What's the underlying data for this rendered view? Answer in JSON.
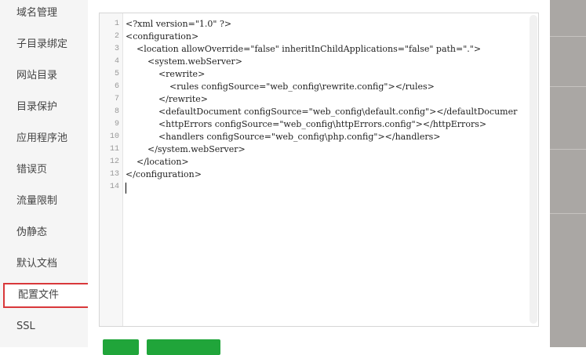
{
  "sidebar": {
    "items": [
      {
        "label": "域名管理"
      },
      {
        "label": "子目录绑定"
      },
      {
        "label": "网站目录"
      },
      {
        "label": "目录保护"
      },
      {
        "label": "应用程序池"
      },
      {
        "label": "错误页"
      },
      {
        "label": "流量限制"
      },
      {
        "label": "伪静态"
      },
      {
        "label": "默认文档"
      },
      {
        "label": "配置文件",
        "active": true
      },
      {
        "label": "SSL"
      }
    ]
  },
  "editor": {
    "lines": [
      {
        "n": "1",
        "text": "<?xml version=\"1.0\" ?>"
      },
      {
        "n": "2",
        "text": "<configuration>"
      },
      {
        "n": "3",
        "text": "    <location allowOverride=\"false\" inheritInChildApplications=\"false\" path=\".\">"
      },
      {
        "n": "4",
        "text": "        <system.webServer>"
      },
      {
        "n": "5",
        "text": "            <rewrite>"
      },
      {
        "n": "6",
        "text": "                <rules configSource=\"web_config\\rewrite.config\"></rules>"
      },
      {
        "n": "7",
        "text": "            </rewrite>"
      },
      {
        "n": "8",
        "text": "            <defaultDocument configSource=\"web_config\\default.config\"></defaultDocumer"
      },
      {
        "n": "9",
        "text": "            <httpErrors configSource=\"web_config\\httpErrors.config\"></httpErrors>"
      },
      {
        "n": "10",
        "text": "            <handlers configSource=\"web_config\\php.config\"></handlers>"
      },
      {
        "n": "11",
        "text": "        </system.webServer>"
      },
      {
        "n": "12",
        "text": "    </location>"
      },
      {
        "n": "13",
        "text": "</configuration>"
      },
      {
        "n": "14",
        "text": ""
      }
    ]
  },
  "colors": {
    "accent_button": "#20a53a",
    "active_border": "#d9383a"
  }
}
